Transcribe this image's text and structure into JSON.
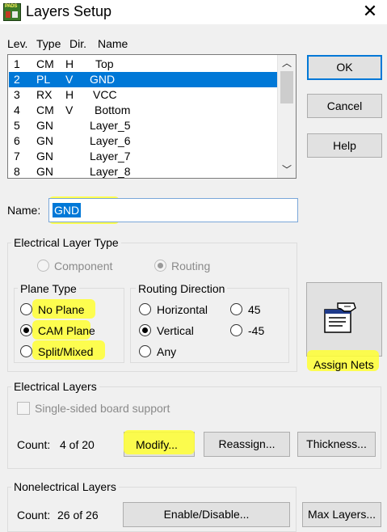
{
  "window": {
    "title": "Layers Setup",
    "app_icon_text": "PADS"
  },
  "list": {
    "headers": [
      "Lev.",
      "Type",
      "Dir.",
      "Name"
    ],
    "rows": [
      {
        "lev": "1",
        "type": "CM",
        "dir": "H",
        "name": "Top"
      },
      {
        "lev": "2",
        "type": "PL",
        "dir": "V",
        "name": "GND"
      },
      {
        "lev": "3",
        "type": "RX",
        "dir": "H",
        "name": "VCC"
      },
      {
        "lev": "4",
        "type": "CM",
        "dir": "V",
        "name": "Bottom"
      },
      {
        "lev": "5",
        "type": "GN",
        "dir": "",
        "name": "Layer_5"
      },
      {
        "lev": "6",
        "type": "GN",
        "dir": "",
        "name": "Layer_6"
      },
      {
        "lev": "7",
        "type": "GN",
        "dir": "",
        "name": "Layer_7"
      },
      {
        "lev": "8",
        "type": "GN",
        "dir": "",
        "name": "Layer_8"
      }
    ],
    "selected_index": 1
  },
  "buttons": {
    "ok": "OK",
    "cancel": "Cancel",
    "help": "Help"
  },
  "name_field": {
    "label": "Name:",
    "value": "GND"
  },
  "electrical_layer_type": {
    "title": "Electrical  Layer Type",
    "component": "Component",
    "routing": "Routing",
    "plane_type": {
      "title": "Plane Type",
      "options": [
        "No Plane",
        "CAM Plane",
        "Split/Mixed"
      ],
      "selected": "CAM Plane"
    },
    "routing_direction": {
      "title": "Routing Direction",
      "options": [
        "Horizontal",
        "45",
        "Vertical",
        "-45",
        "Any"
      ],
      "selected": "Vertical"
    }
  },
  "assign_nets": {
    "label": "Assign Nets"
  },
  "electrical_layers": {
    "title": "Electrical Layers",
    "single_sided": "Single-sided board support",
    "count_label": "Count:",
    "count_value": "4 of 20",
    "modify": "Modify...",
    "reassign": "Reassign...",
    "thickness": "Thickness..."
  },
  "nonelectrical_layers": {
    "title": "Nonelectrical Layers",
    "count_label": "Count:",
    "count_value": "26 of 26",
    "enable_disable": "Enable/Disable...",
    "max_layers": "Max Layers..."
  },
  "colors": {
    "selection": "#0078d7",
    "highlight": "#ffff33",
    "dialog_bg": "#f0f0f0"
  }
}
